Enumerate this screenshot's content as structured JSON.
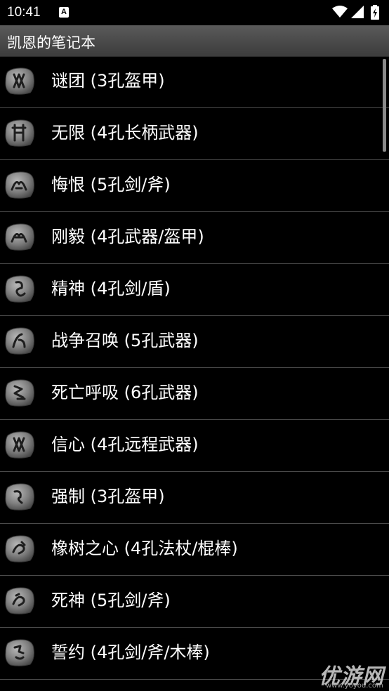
{
  "status_bar": {
    "time": "10:41",
    "notification_letter": "A",
    "icons": [
      "a-notification-icon",
      "wifi-icon",
      "signal-icon",
      "battery-icon"
    ]
  },
  "app": {
    "title": "凯恩的笔记本"
  },
  "runewords": [
    {
      "label": "谜团 (3孔盔甲)",
      "icon": "rune-icon"
    },
    {
      "label": "无限 (4孔长柄武器)",
      "icon": "rune-icon"
    },
    {
      "label": "悔恨 (5孔剑/斧)",
      "icon": "rune-icon"
    },
    {
      "label": "刚毅 (4孔武器/盔甲)",
      "icon": "rune-icon"
    },
    {
      "label": "精神 (4孔剑/盾)",
      "icon": "rune-icon"
    },
    {
      "label": "战争召唤 (5孔武器)",
      "icon": "rune-icon"
    },
    {
      "label": "死亡呼吸 (6孔武器)",
      "icon": "rune-icon"
    },
    {
      "label": "信心 (4孔远程武器)",
      "icon": "rune-icon"
    },
    {
      "label": "强制 (3孔盔甲)",
      "icon": "rune-icon"
    },
    {
      "label": "橡树之心 (4孔法杖/棍棒)",
      "icon": "rune-icon"
    },
    {
      "label": "死神 (5孔剑/斧)",
      "icon": "rune-icon"
    },
    {
      "label": "誓约 (4孔剑/斧/木棒)",
      "icon": "rune-icon"
    }
  ],
  "watermark": {
    "name": "优游网",
    "url": "www.yoyou.com"
  },
  "colors": {
    "background": "#000000",
    "title_bar": "#4a4a4a",
    "divider": "#4a4a4a",
    "text": "#ffffff"
  }
}
